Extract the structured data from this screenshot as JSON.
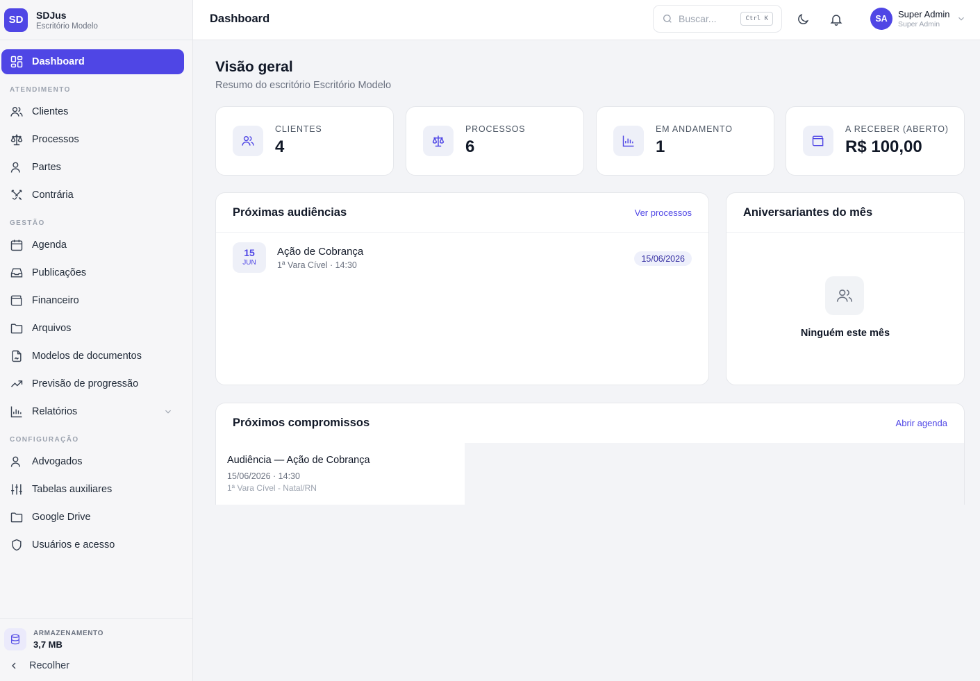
{
  "brand": {
    "initials": "SD",
    "name": "SDJus",
    "subtitle": "Escritório Modelo"
  },
  "nav": {
    "dashboard": "Dashboard",
    "section_atendimento": "ATENDIMENTO",
    "clientes": "Clientes",
    "processos": "Processos",
    "partes": "Partes",
    "contraria": "Contrária",
    "section_gestao": "GESTÃO",
    "agenda": "Agenda",
    "publicacoes": "Publicações",
    "financeiro": "Financeiro",
    "arquivos": "Arquivos",
    "modelos": "Modelos de documentos",
    "previsao": "Previsão de progressão",
    "relatorios": "Relatórios",
    "section_config": "CONFIGURAÇÃO",
    "advogados": "Advogados",
    "tabelas": "Tabelas auxiliares",
    "google_drive": "Google Drive",
    "usuarios": "Usuários e acesso"
  },
  "storage": {
    "label": "ARMAZENAMENTO",
    "value": "3,7 MB",
    "collapse": "Recolher"
  },
  "topbar": {
    "title": "Dashboard",
    "search_placeholder": "Buscar...",
    "shortcut": "Ctrl K",
    "user_initials": "SA",
    "user_name": "Super Admin",
    "user_role": "Super Admin"
  },
  "overview": {
    "title": "Visão geral",
    "subtitle": "Resumo do escritório Escritório Modelo"
  },
  "stats": {
    "clientes": {
      "label": "CLIENTES",
      "value": "4"
    },
    "processos": {
      "label": "PROCESSOS",
      "value": "6"
    },
    "andamento": {
      "label": "EM ANDAMENTO",
      "value": "1"
    },
    "receber": {
      "label": "A RECEBER (ABERTO)",
      "value": "R$ 100,00"
    }
  },
  "hearings": {
    "title": "Próximas audiências",
    "link": "Ver processos",
    "items": [
      {
        "day": "15",
        "month": "JUN",
        "title": "Ação de Cobrança",
        "subtitle": "1ª Vara Cível · 14:30",
        "date": "15/06/2026"
      }
    ]
  },
  "birthdays": {
    "title": "Aniversariantes do mês",
    "empty": "Ninguém este mês"
  },
  "appointments": {
    "title": "Próximos compromissos",
    "link": "Abrir agenda",
    "items": [
      {
        "title": "Audiência — Ação de Cobrança",
        "meta": "15/06/2026 · 14:30",
        "location": "1ª Vara Cível - Natal/RN"
      }
    ]
  },
  "colors": {
    "accent": "#4f46e5",
    "background": "#f3f4f7",
    "card": "#ffffff"
  }
}
